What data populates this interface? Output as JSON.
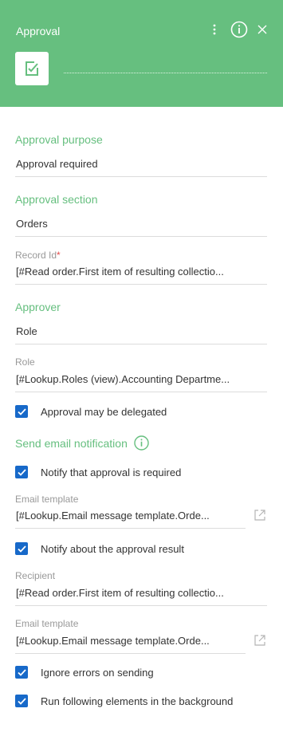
{
  "header": {
    "title": "Approval"
  },
  "sections": {
    "approval_purpose": "Approval purpose",
    "approval_section": "Approval section",
    "approver": "Approver",
    "send_email_notification": "Send email notification"
  },
  "fields": {
    "approval_purpose_value": "Approval required",
    "approval_section_value": "Orders",
    "record_id_label": "Record Id",
    "record_id_required_mark": "*",
    "record_id_value": "[#Read order.First item of resulting collectio...",
    "approver_value": "Role",
    "role_label": "Role",
    "role_value": "[#Lookup.Roles (view).Accounting Departme...",
    "email_template_label_1": "Email template",
    "email_template_value_1": "[#Lookup.Email message template.Orde...",
    "recipient_label": "Recipient",
    "recipient_value": "[#Read order.First item of resulting collectio...",
    "email_template_label_2": "Email template",
    "email_template_value_2": "[#Lookup.Email message template.Orde..."
  },
  "checkboxes": {
    "approval_may_be_delegated": {
      "label": "Approval may be delegated",
      "checked": true
    },
    "notify_approval_required": {
      "label": "Notify that approval is required",
      "checked": true
    },
    "notify_approval_result": {
      "label": "Notify about the approval result",
      "checked": true
    },
    "ignore_errors": {
      "label": "Ignore errors on sending",
      "checked": true
    },
    "run_in_background": {
      "label": "Run following elements in the background",
      "checked": true
    }
  },
  "icons": {
    "menu": "vertical-dots-icon",
    "info": "info-icon",
    "close": "close-icon",
    "element": "approval-element-icon",
    "open_link": "open-external-icon"
  },
  "colors": {
    "header_bg": "#66bf7f",
    "section_title": "#66bf7f",
    "checkbox": "#1769c9",
    "label": "#999999",
    "required": "#e34a4a"
  }
}
